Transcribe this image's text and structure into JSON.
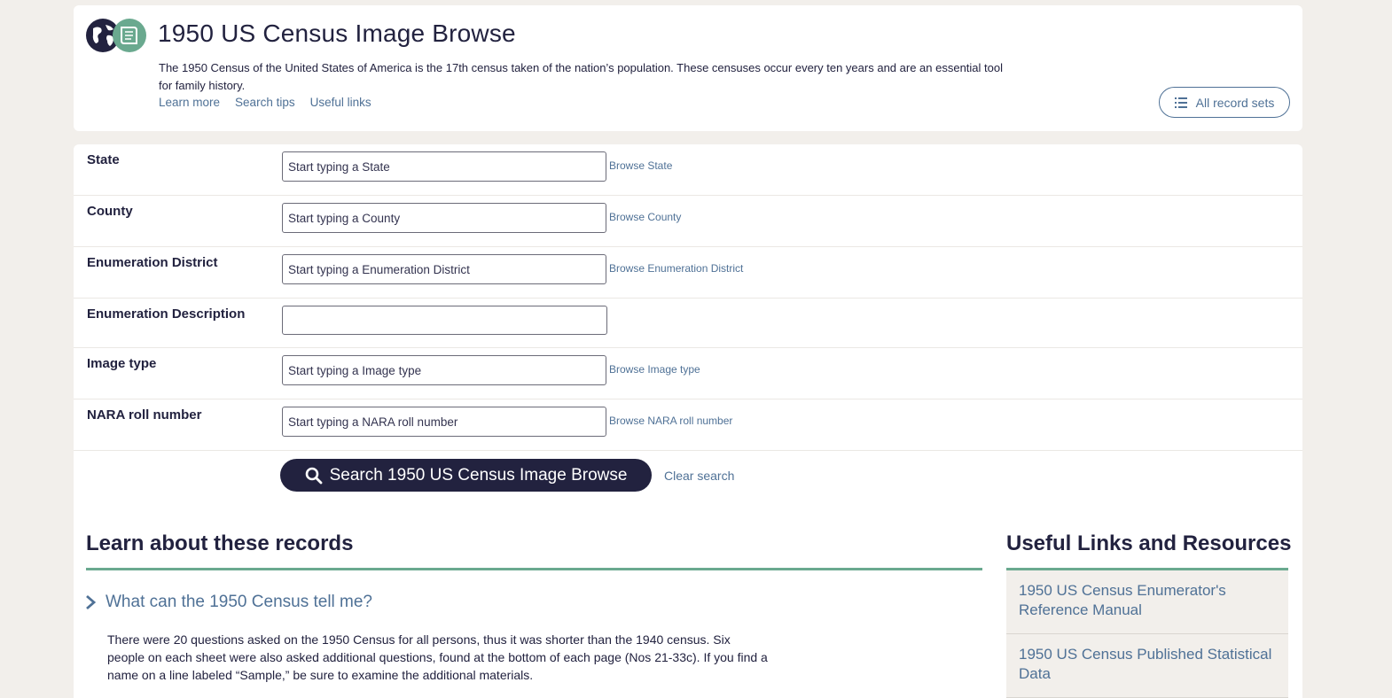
{
  "header": {
    "title": "1950 US Census Image Browse",
    "description": "The 1950 Census of the United States of America is the 17th census taken of the nation’s population. These censuses occur every ten years and are an essential tool for family history.",
    "links": [
      "Learn more",
      "Search tips",
      "Useful links"
    ],
    "all_records_label": "All record sets",
    "logo_icons": [
      "globe-icon",
      "book-icon"
    ]
  },
  "form": {
    "fields": [
      {
        "label": "State",
        "placeholder": "Start typing a State",
        "browse": "Browse State"
      },
      {
        "label": "County",
        "placeholder": "Start typing a County",
        "browse": "Browse County"
      },
      {
        "label": "Enumeration District",
        "placeholder": "Start typing a Enumeration District",
        "browse": "Browse Enumeration District"
      },
      {
        "label": "Enumeration Description",
        "placeholder": "",
        "browse": ""
      },
      {
        "label": "Image type",
        "placeholder": "Start typing a Image type",
        "browse": "Browse Image type"
      },
      {
        "label": "NARA roll number",
        "placeholder": "Start typing a NARA roll number",
        "browse": "Browse NARA roll number"
      }
    ],
    "search_label": "Search 1950 US Census Image Browse",
    "clear_label": "Clear search"
  },
  "learn": {
    "heading": "Learn about these records",
    "accordion_title": "What can the 1950 Census tell me?",
    "accordion_body": "There were 20 questions asked on the 1950 Census for all persons, thus it was shorter than the 1940 census. Six people on each sheet were also asked additional questions, found at the bottom of each page (Nos 21-33c). If you find a name on a line labeled “Sample,” be sure to examine the additional materials."
  },
  "resources": {
    "heading": "Useful Links and Resources",
    "items": [
      "1950 US Census Enumerator's Reference Manual",
      "1950 US Census Published Statistical Data"
    ]
  },
  "colors": {
    "navy": "#22223f",
    "link_blue": "#4f7196",
    "green_accent": "#6aa98f",
    "background": "#f2efeb"
  }
}
